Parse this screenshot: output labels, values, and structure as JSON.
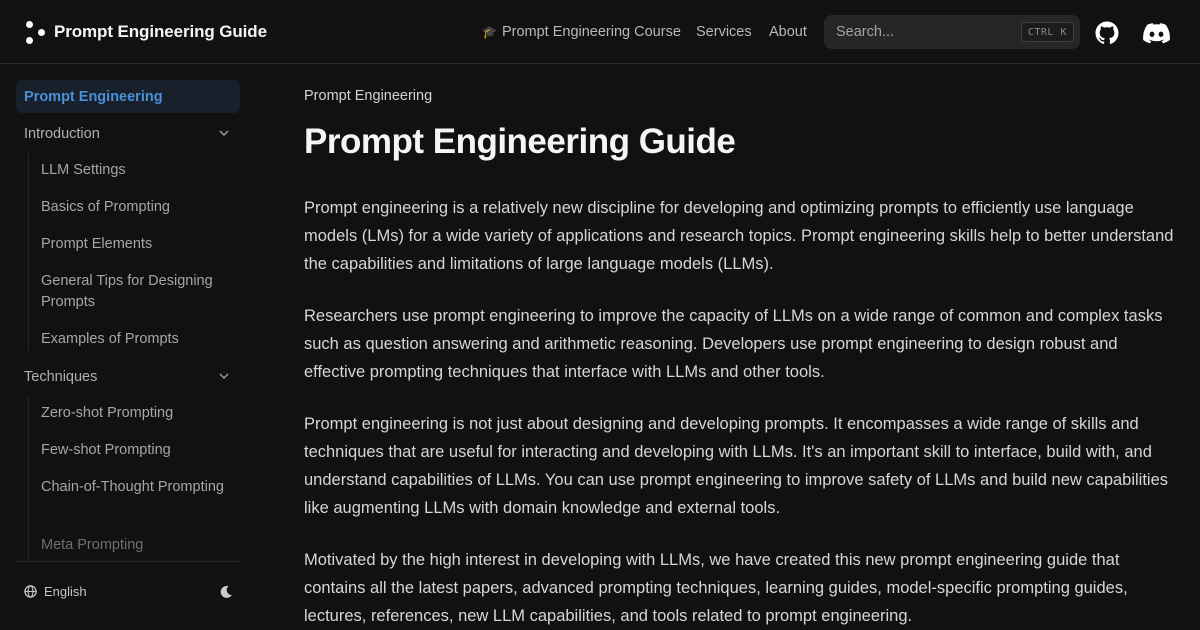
{
  "navbar": {
    "logo_text": "Prompt Engineering Guide",
    "links": [
      {
        "icon": "🎓",
        "label": "Prompt Engineering Course"
      },
      {
        "label": "Services"
      },
      {
        "label": "About"
      }
    ],
    "search": {
      "placeholder": "Search...",
      "shortcut": "CTRL K"
    },
    "icons": [
      "github-icon",
      "discord-icon"
    ]
  },
  "sidebar": {
    "active": "Prompt Engineering",
    "sections": [
      {
        "label": "Introduction",
        "expanded": true,
        "items": [
          "LLM Settings",
          "Basics of Prompting",
          "Prompt Elements",
          "General Tips for Designing Prompts",
          "Examples of Prompts"
        ]
      },
      {
        "label": "Techniques",
        "expanded": true,
        "items": [
          "Zero-shot Prompting",
          "Few-shot Prompting",
          "Chain-of-Thought Prompting",
          "Meta Prompting"
        ]
      }
    ],
    "footer": {
      "language": "English",
      "theme_icon": "moon-icon"
    }
  },
  "main": {
    "breadcrumb": "Prompt Engineering",
    "title": "Prompt Engineering Guide",
    "paragraphs": [
      "Prompt engineering is a relatively new discipline for developing and optimizing prompts to efficiently use language models (LMs) for a wide variety of applications and research topics. Prompt engineering skills help to better understand the capabilities and limitations of large language models (LLMs).",
      "Researchers use prompt engineering to improve the capacity of LLMs on a wide range of common and complex tasks such as question answering and arithmetic reasoning. Developers use prompt engineering to design robust and effective prompting techniques that interface with LLMs and other tools.",
      "Prompt engineering is not just about designing and developing prompts. It encompasses a wide range of skills and techniques that are useful for interacting and developing with LLMs. It's an important skill to interface, build with, and understand capabilities of LLMs. You can use prompt engineering to improve safety of LLMs and build new capabilities like augmenting LLMs with domain knowledge and external tools.",
      "Motivated by the high interest in developing with LLMs, we have created this new prompt engineering guide that contains all the latest papers, advanced prompting techniques, learning guides, model-specific prompting guides, lectures, references, new LLM capabilities, and tools related to prompt engineering."
    ]
  },
  "colors": {
    "background": "#111111",
    "accent": "#4a90d9",
    "active_bg": "#18202b"
  }
}
